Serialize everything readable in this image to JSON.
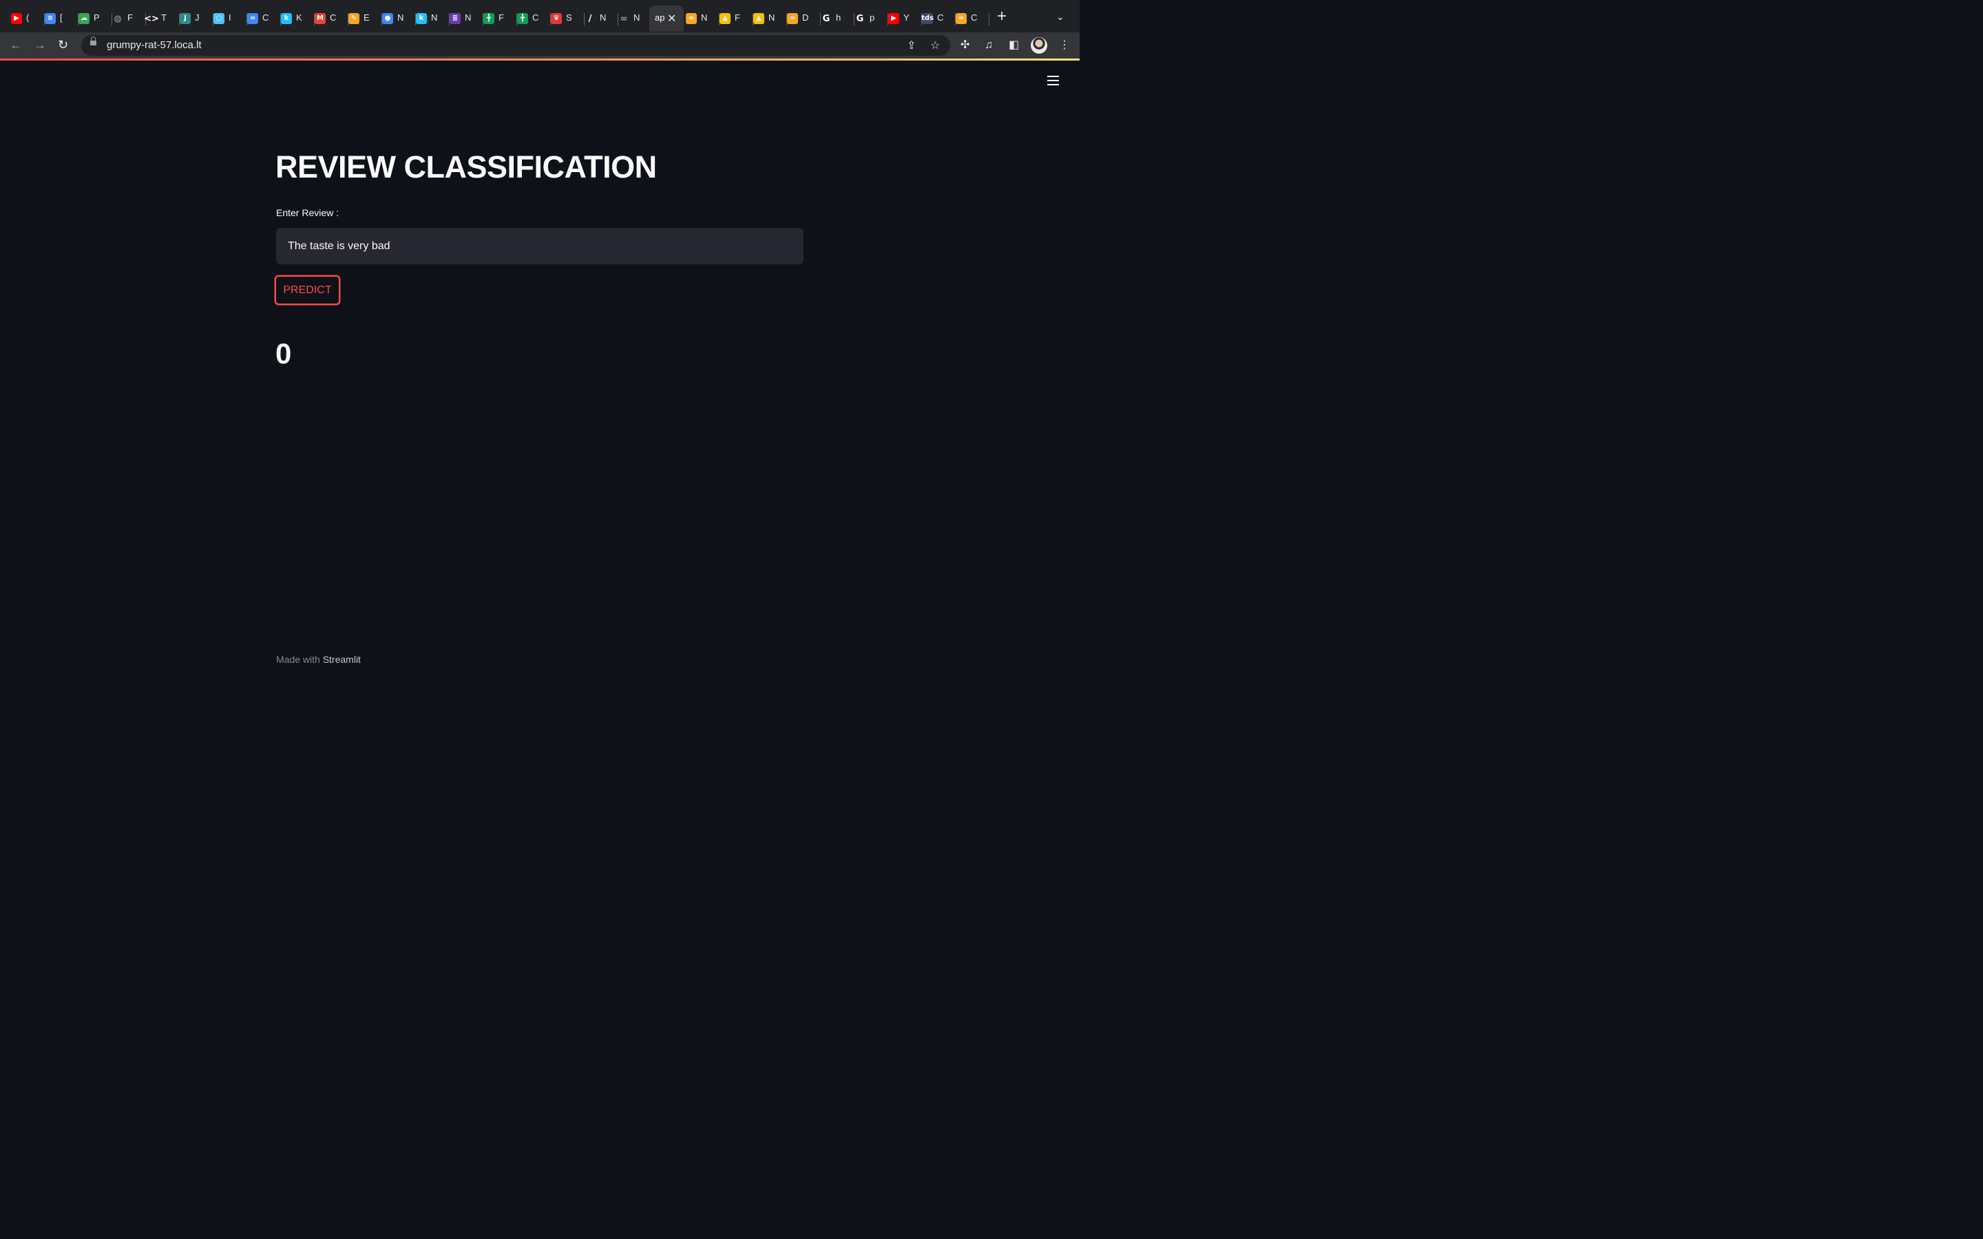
{
  "browser": {
    "tabs": [
      {
        "icon": "youtube-icon",
        "label": "(",
        "color": "#ff0000",
        "glyph": "▶"
      },
      {
        "icon": "google-docs-icon",
        "label": "[",
        "color": "#4285f4",
        "glyph": "≡"
      },
      {
        "icon": "google-cloud-icon",
        "label": "P",
        "color": "#34a853",
        "glyph": "☁"
      },
      {
        "icon": "globe-icon",
        "label": "F",
        "color": "#9aa0a6",
        "glyph": "◍"
      },
      {
        "icon": "colab-icon",
        "label": "T",
        "color": "#ffffff",
        "glyph": "<>"
      },
      {
        "icon": "jupyter-icon",
        "label": "J",
        "color": "#2e8b8b",
        "glyph": "J"
      },
      {
        "icon": "circle-icon",
        "label": "I",
        "color": "#4fc3f7",
        "glyph": "○"
      },
      {
        "icon": "link-icon",
        "label": "C",
        "color": "#4285f4",
        "glyph": "∞"
      },
      {
        "icon": "kaggle-icon",
        "label": "K",
        "color": "#20beff",
        "glyph": "k"
      },
      {
        "icon": "gmail-icon",
        "label": "C",
        "color": "#ea4335",
        "glyph": "M"
      },
      {
        "icon": "notes-icon",
        "label": "E",
        "color": "#f4a623",
        "glyph": "✎"
      },
      {
        "icon": "contacts-icon",
        "label": "N",
        "color": "#4285f4",
        "glyph": "●"
      },
      {
        "icon": "kaggle-icon",
        "label": "N",
        "color": "#20beff",
        "glyph": "k"
      },
      {
        "icon": "forms-icon",
        "label": "N",
        "color": "#673ab7",
        "glyph": "≣"
      },
      {
        "icon": "sheets-icon",
        "label": "F",
        "color": "#0f9d58",
        "glyph": "╋"
      },
      {
        "icon": "sheets-icon",
        "label": "C",
        "color": "#0f9d58",
        "glyph": "╋"
      },
      {
        "icon": "crown-icon",
        "label": "S",
        "color": "#e53935",
        "glyph": "♛"
      },
      {
        "icon": "slash-icon",
        "label": "N",
        "color": "#ffffff",
        "glyph": "/"
      },
      {
        "icon": "infinity-icon",
        "label": "N",
        "color": "#9aa0a6",
        "glyph": "∞"
      }
    ],
    "active_tab": {
      "label": "ap"
    },
    "tabs_after": [
      {
        "icon": "infinity-icon",
        "label": "N",
        "color": "#f5a623",
        "glyph": "∞"
      },
      {
        "icon": "google-drive-icon",
        "label": "F",
        "color": "#fbbc04",
        "glyph": "▲"
      },
      {
        "icon": "google-drive-icon",
        "label": "N",
        "color": "#fbbc04",
        "glyph": "▲"
      },
      {
        "icon": "infinity-icon",
        "label": "D",
        "color": "#f5a623",
        "glyph": "∞"
      },
      {
        "icon": "google-icon",
        "label": "h",
        "color": "#ffffff",
        "glyph": "G"
      },
      {
        "icon": "google-icon",
        "label": "p",
        "color": "#ffffff",
        "glyph": "G"
      },
      {
        "icon": "youtube-icon",
        "label": "Y",
        "color": "#ff0000",
        "glyph": "▶"
      },
      {
        "icon": "tds-icon",
        "label": "C",
        "color": "#3c4a6b",
        "glyph": "tds"
      },
      {
        "icon": "infinity-icon",
        "label": "C",
        "color": "#f5a623",
        "glyph": "∞"
      }
    ],
    "url": "grumpy-rat-57.loca.lt"
  },
  "app": {
    "title": "REVIEW CLASSIFICATION",
    "input_label": "Enter Review :",
    "input_value": "The taste is very bad",
    "predict_label": "PREDICT",
    "result": "0",
    "footer_prefix": "Made with ",
    "footer_brand": "Streamlit"
  },
  "colors": {
    "background": "#0e1117",
    "primary": "#ff4b4b",
    "input_bg": "#262730",
    "text": "#fafafa"
  }
}
